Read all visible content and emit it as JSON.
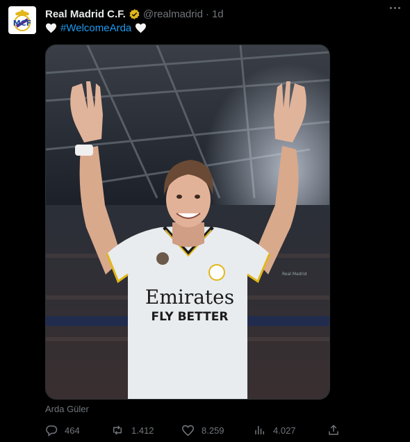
{
  "author": {
    "display_name": "Real Madrid C.F.",
    "handle": "@realmadrid",
    "separator": "·",
    "time": "1d",
    "verified_badge": "gold-check",
    "avatar_icon": "real-madrid-crest"
  },
  "tweet": {
    "hashtag": "#WelcomeArda",
    "emoji": "white-heart",
    "media_alt": "Arda Güler"
  },
  "image_text": {
    "sponsor": "Emirates",
    "slogan": "FLY BETTER",
    "banner": "Real Madrid"
  },
  "caption": "Arda Güler",
  "actions": {
    "replies": "464",
    "reposts": "1.412",
    "likes": "8.259",
    "views": "4.027"
  },
  "colors": {
    "background": "#000000",
    "text": "#e7e9ea",
    "muted": "#71767b",
    "link": "#1d9bf0",
    "badge": "#e2b719"
  }
}
